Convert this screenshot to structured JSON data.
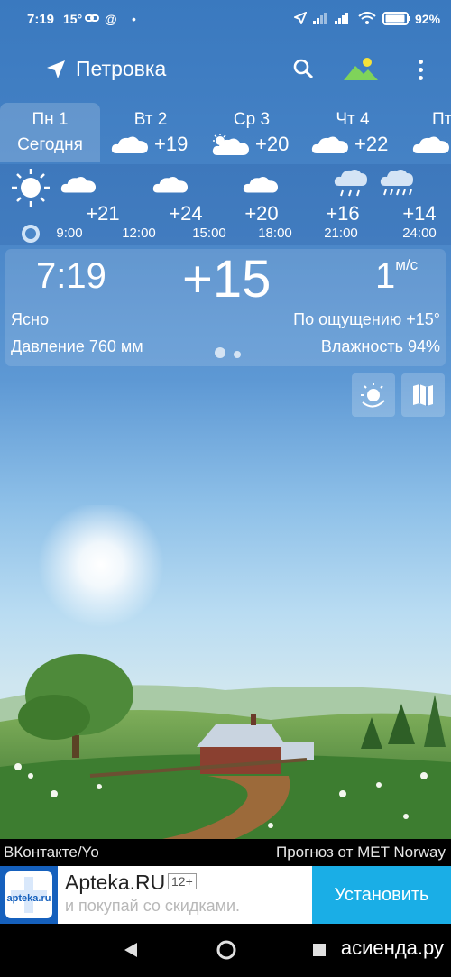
{
  "status_bar": {
    "time": "7:19",
    "temp": "15",
    "at": "@",
    "battery": "92%"
  },
  "topbar": {
    "location": "Петровка"
  },
  "days": [
    {
      "name": "Пн 1",
      "sub": "Сегодня"
    },
    {
      "name": "Вт 2",
      "temp": "+19"
    },
    {
      "name": "Ср 3",
      "temp": "+20"
    },
    {
      "name": "Чт 4",
      "temp": "+22"
    },
    {
      "name": "Пт"
    }
  ],
  "hourly": [
    {
      "temp": "+21",
      "time": "9:00",
      "icon": "cloud-icon"
    },
    {
      "temp": "+24",
      "time": "12:00",
      "icon": "cloud-icon"
    },
    {
      "temp": "+20",
      "time": "15:00",
      "icon": "cloud-icon"
    },
    {
      "temp": "+16",
      "time": "18:00",
      "icon": "cloud-rain-icon"
    },
    {
      "temp": "+14",
      "time": "21:00",
      "icon": "cloud-heavy-rain-icon"
    },
    {
      "temp": "",
      "time": "24:00",
      "icon": ""
    }
  ],
  "current": {
    "time": "7:19",
    "temp": "+15",
    "wind_value": "1",
    "wind_unit": "м/с",
    "condition": "Ясно",
    "feels_like": "По ощущению +15°",
    "pressure": "Давление 760 мм",
    "humidity": "Влажность 94%"
  },
  "footer": {
    "left": "ВКонтакте/Yo",
    "right": "Прогноз от MET Norway"
  },
  "ad": {
    "logo": "apteka.ru",
    "title": "Apteka.RU",
    "age": "12+",
    "subtitle": "и покупай со скидками.",
    "button": "Установить"
  },
  "watermark": "асиенда.ру",
  "colors": {
    "sky_top": "#3a79bf",
    "ad_button": "#1aaee6",
    "ad_logo_bg": "#1560bd"
  }
}
